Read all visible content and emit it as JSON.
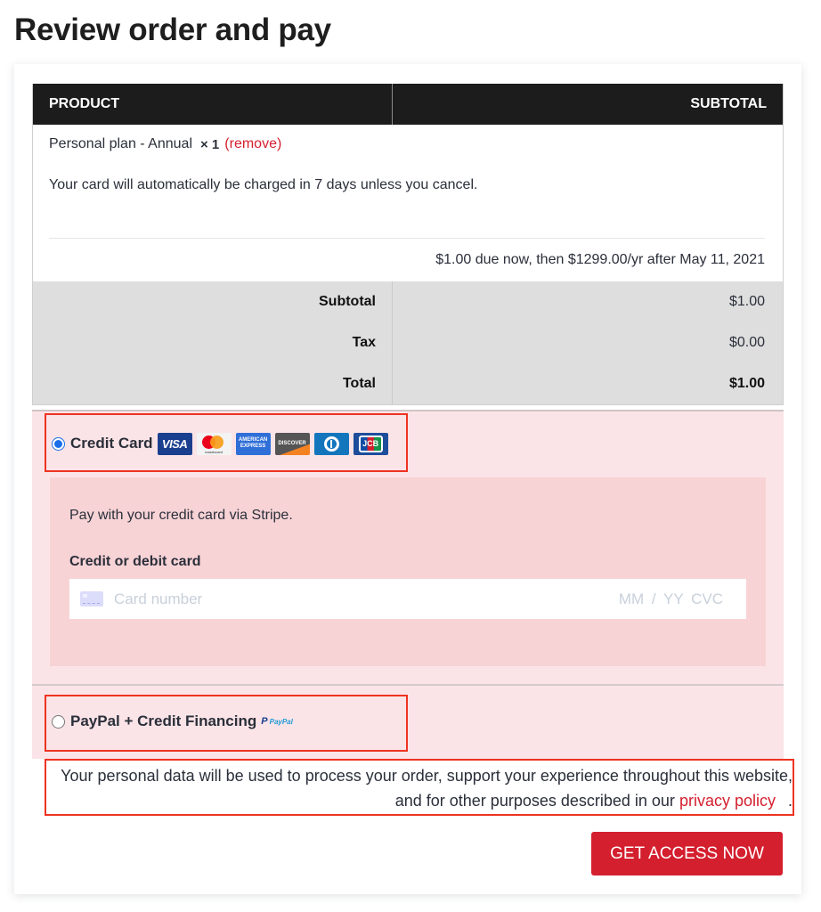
{
  "page": {
    "title": "Review order and pay"
  },
  "order_table": {
    "headers": {
      "product": "PRODUCT",
      "subtotal": "SUBTOTAL"
    },
    "item": {
      "name": "Personal plan - Annual",
      "quantity": "× 1",
      "remove_label": "(remove)"
    },
    "charge_note": "Your card will automatically be charged in 7 days unless you cancel.",
    "due_line": "$1.00 due now, then $1299.00/yr after May 11, 2021",
    "totals": [
      {
        "label": "Subtotal",
        "value": "$1.00"
      },
      {
        "label": "Tax",
        "value": "$0.00"
      },
      {
        "label": "Total",
        "value": "$1.00"
      }
    ]
  },
  "payment": {
    "credit_card": {
      "label": "Credit Card",
      "selected": true,
      "logos": [
        "VISA",
        "mastercard",
        "AMERICAN EXPRESS",
        "DISCOVER",
        "Diners Club",
        "JCB"
      ],
      "description": "Pay with your credit card via Stripe.",
      "field_label": "Credit or debit card",
      "card_number_placeholder": "Card number",
      "expiry_cvc_placeholder": "MM / YY  CVC"
    },
    "paypal": {
      "label": "PayPal + Credit Financing",
      "selected": false,
      "logo_text": "PayPal"
    }
  },
  "privacy": {
    "text": "Your personal data will be used to process your order, support your experience throughout this website, and for other purposes described in our ",
    "link_label": "privacy policy",
    "end": "."
  },
  "cta": {
    "label": "GET ACCESS NOW"
  },
  "colors": {
    "accent": "#d41f2e",
    "header_bg": "#1c1c1c",
    "payment_bg": "#fbe4e7",
    "highlight_border": "#ee3322"
  }
}
